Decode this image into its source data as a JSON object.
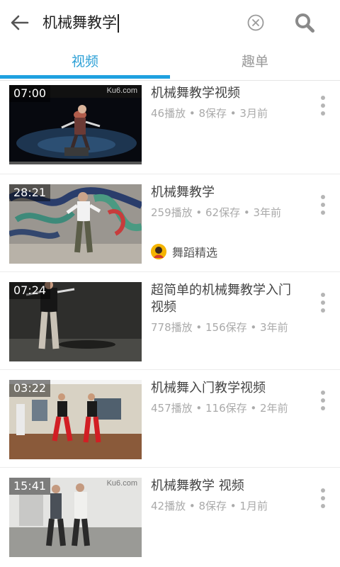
{
  "search": {
    "query": "机械舞教学"
  },
  "tabs": [
    {
      "label": "视频",
      "active": true
    },
    {
      "label": "趣单",
      "active": false
    }
  ],
  "colors": {
    "accent": "#1ea1e0",
    "meta_text": "#aaaaaa",
    "title_text": "#444444"
  },
  "icons": {
    "back": "arrow-left-icon",
    "clear": "clear-circle-icon",
    "search": "search-icon",
    "more": "more-vertical-icon"
  },
  "videos": [
    {
      "duration": "07:00",
      "title": "机械舞教学视频",
      "meta": "46播放 • 8保存 • 3月前",
      "watermark": "Ku6.com"
    },
    {
      "duration": "28:21",
      "title": "机械舞教学",
      "meta": "259播放 • 62保存 • 3年前",
      "channel": "舞蹈精选"
    },
    {
      "duration": "07:24",
      "title": "超简单的机械舞教学入门视频",
      "meta": "778播放 • 156保存 • 3年前"
    },
    {
      "duration": "03:22",
      "title": "机械舞入门教学视频",
      "meta": "457播放 • 116保存 • 2年前"
    },
    {
      "duration": "15:41",
      "title": "机械舞教学 视频",
      "meta": "42播放 • 8保存 • 1月前",
      "watermark": "Ku6.com"
    }
  ]
}
